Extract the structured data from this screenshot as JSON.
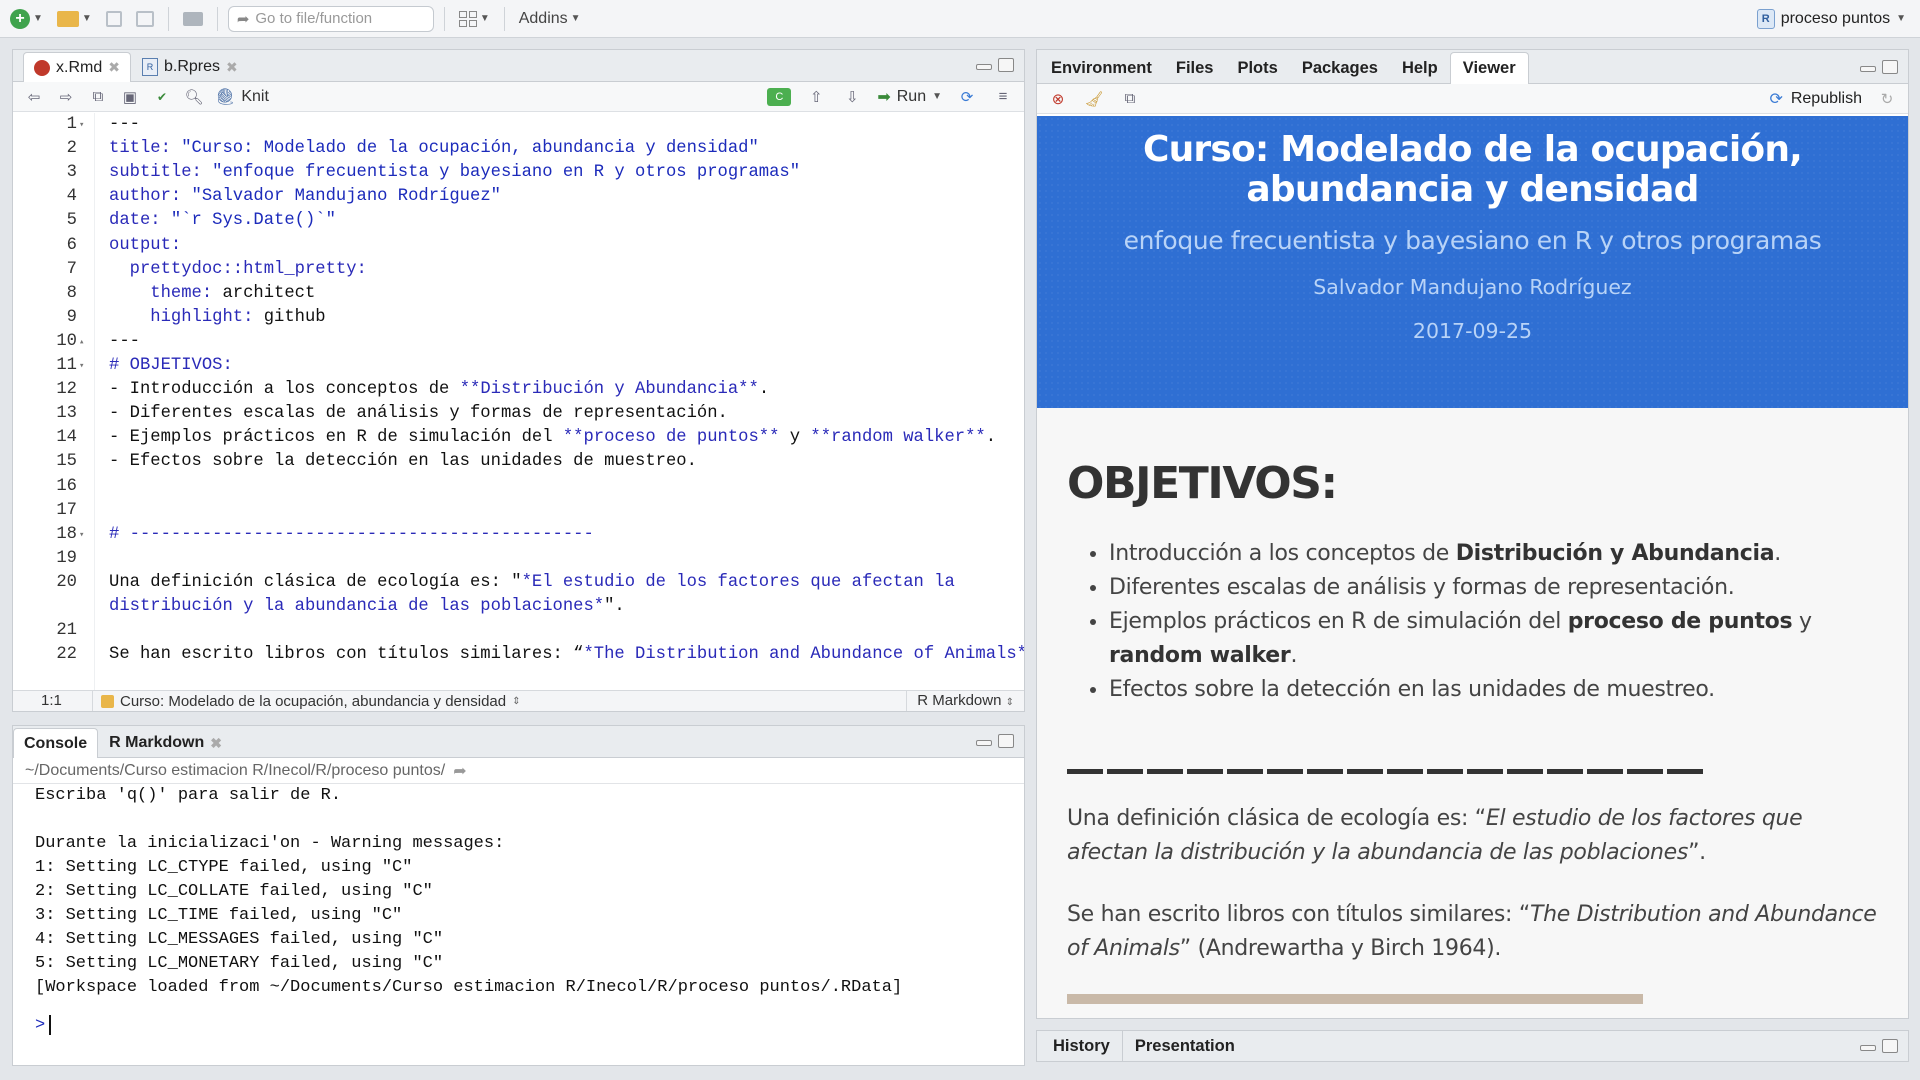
{
  "toolbar": {
    "goto_placeholder": "Go to file/function",
    "addins_label": "Addins",
    "project_label": "proceso puntos"
  },
  "source_pane": {
    "tabs": [
      {
        "label": "x.Rmd",
        "active": true
      },
      {
        "label": "b.Rpres",
        "active": false
      }
    ],
    "knit_label": "Knit",
    "run_label": "Run",
    "lines": [
      {
        "n": "1",
        "fold": true,
        "segments": [
          {
            "t": "---",
            "c": ""
          }
        ]
      },
      {
        "n": "2",
        "segments": [
          {
            "t": "title: ",
            "c": "navy"
          },
          {
            "t": "\"Curso: Modelado de la ocupación, abundancia y densidad\"",
            "c": "blue"
          }
        ]
      },
      {
        "n": "3",
        "segments": [
          {
            "t": "subtitle: ",
            "c": "navy"
          },
          {
            "t": "\"enfoque frecuentista y bayesiano en R y otros programas\"",
            "c": "blue"
          }
        ]
      },
      {
        "n": "4",
        "segments": [
          {
            "t": "author: ",
            "c": "navy"
          },
          {
            "t": "\"Salvador Mandujano Rodríguez\"",
            "c": "blue"
          }
        ]
      },
      {
        "n": "5",
        "segments": [
          {
            "t": "date: ",
            "c": "navy"
          },
          {
            "t": "\"`r Sys.Date()`\"",
            "c": "blue"
          }
        ]
      },
      {
        "n": "6",
        "segments": [
          {
            "t": "output:",
            "c": "navy"
          }
        ]
      },
      {
        "n": "7",
        "segments": [
          {
            "t": "  prettydoc::html_pretty:",
            "c": "navy"
          }
        ]
      },
      {
        "n": "8",
        "segments": [
          {
            "t": "    theme: ",
            "c": "navy"
          },
          {
            "t": "architect",
            "c": ""
          }
        ]
      },
      {
        "n": "9",
        "segments": [
          {
            "t": "    highlight: ",
            "c": "navy"
          },
          {
            "t": "github",
            "c": ""
          }
        ]
      },
      {
        "n": "10",
        "foldup": true,
        "segments": [
          {
            "t": "---",
            "c": ""
          }
        ]
      },
      {
        "n": "11",
        "fold": true,
        "segments": [
          {
            "t": "# OBJETIVOS:",
            "c": "navy"
          }
        ]
      },
      {
        "n": "12",
        "segments": [
          {
            "t": "- Introducción a los conceptos de ",
            "c": ""
          },
          {
            "t": "**Distribución y Abundancia**",
            "c": "navy"
          },
          {
            "t": ".",
            "c": ""
          }
        ]
      },
      {
        "n": "13",
        "segments": [
          {
            "t": "- Diferentes escalas de análisis y formas de representación.",
            "c": ""
          }
        ]
      },
      {
        "n": "14",
        "segments": [
          {
            "t": "- Ejemplos prácticos en R de simulación del ",
            "c": ""
          },
          {
            "t": "**proceso de puntos**",
            "c": "navy"
          },
          {
            "t": " y ",
            "c": ""
          },
          {
            "t": "**random walker**",
            "c": "navy"
          },
          {
            "t": ".",
            "c": ""
          }
        ]
      },
      {
        "n": "15",
        "segments": [
          {
            "t": "- Efectos sobre la detección en las unidades de muestreo.",
            "c": ""
          }
        ]
      },
      {
        "n": "16",
        "segments": []
      },
      {
        "n": "17",
        "segments": []
      },
      {
        "n": "18",
        "fold": true,
        "segments": [
          {
            "t": "# ---------------------------------------------",
            "c": "navy"
          }
        ]
      },
      {
        "n": "19",
        "segments": []
      },
      {
        "n": "20",
        "segments": [
          {
            "t": "Una definición clásica de ecología es: \"",
            "c": ""
          },
          {
            "t": "*El estudio de los factores que afectan la",
            "c": "navy"
          }
        ]
      },
      {
        "n": "",
        "segments": [
          {
            "t": "distribución y la abundancia de las poblaciones*",
            "c": "navy"
          },
          {
            "t": "\".",
            "c": ""
          }
        ]
      },
      {
        "n": "21",
        "segments": []
      },
      {
        "n": "22",
        "segments": [
          {
            "t": "Se han escrito libros con títulos similares: “",
            "c": ""
          },
          {
            "t": "*The Distribution and Abundance of Animals*",
            "c": "navy"
          },
          {
            "t": "”",
            "c": ""
          }
        ]
      }
    ],
    "status": {
      "position": "1:1",
      "section": "Curso: Modelado de la ocupación, abundancia y densidad",
      "mode": "R Markdown"
    }
  },
  "console_pane": {
    "tabs": [
      {
        "label": "Console",
        "active": true
      },
      {
        "label": "R Markdown",
        "active": false
      }
    ],
    "path": "~/Documents/Curso estimacion R/Inecol/R/proceso puntos/",
    "output": "Escriba 'q()' para salir de R.\n\nDurante la inicializaci'on - Warning messages:\n1: Setting LC_CTYPE failed, using \"C\"\n2: Setting LC_COLLATE failed, using \"C\"\n3: Setting LC_TIME failed, using \"C\"\n4: Setting LC_MESSAGES failed, using \"C\"\n5: Setting LC_MONETARY failed, using \"C\"\n[Workspace loaded from ~/Documents/Curso estimacion R/Inecol/R/proceso puntos/.RData]",
    "prompt": ">"
  },
  "viewer_pane": {
    "tabs": [
      "Environment",
      "Files",
      "Plots",
      "Packages",
      "Help",
      "Viewer"
    ],
    "active_tab": "Viewer",
    "republish_label": "Republish",
    "hero": {
      "title_line1": "Curso: Modelado de la ocupación,",
      "title_line2": "abundancia y densidad",
      "subtitle": "enfoque frecuentista y bayesiano en R y otros programas",
      "author": "Salvador Mandujano Rodríguez",
      "date": "2017-09-25"
    },
    "doc": {
      "heading": "OBJETIVOS:",
      "bullets": [
        {
          "pre": "Introducción a los conceptos de ",
          "bold": "Distribución y Abundancia",
          "post": "."
        },
        {
          "pre": "Diferentes escalas de análisis y formas de representación.",
          "bold": "",
          "post": ""
        },
        {
          "pre": "Ejemplos prácticos en R de simulación del ",
          "bold": "proceso de puntos",
          "post": " y ",
          "bold2": "random walker",
          "post2": "."
        },
        {
          "pre": "Efectos sobre la detección en las unidades de muestreo.",
          "bold": "",
          "post": ""
        }
      ],
      "para1_pre": "Una definición clásica de ecología es: “",
      "para1_italic": "El estudio de los factores que afectan la distribución y la abundancia de las poblaciones",
      "para1_post": "”.",
      "para2_pre": "Se han escrito libros con títulos similares: “",
      "para2_italic": "The Distribution and Abundance of Animals",
      "para2_post": "” (Andrewartha y Birch 1964)."
    }
  },
  "bottom_right_tabs": [
    "History",
    "Presentation"
  ]
}
